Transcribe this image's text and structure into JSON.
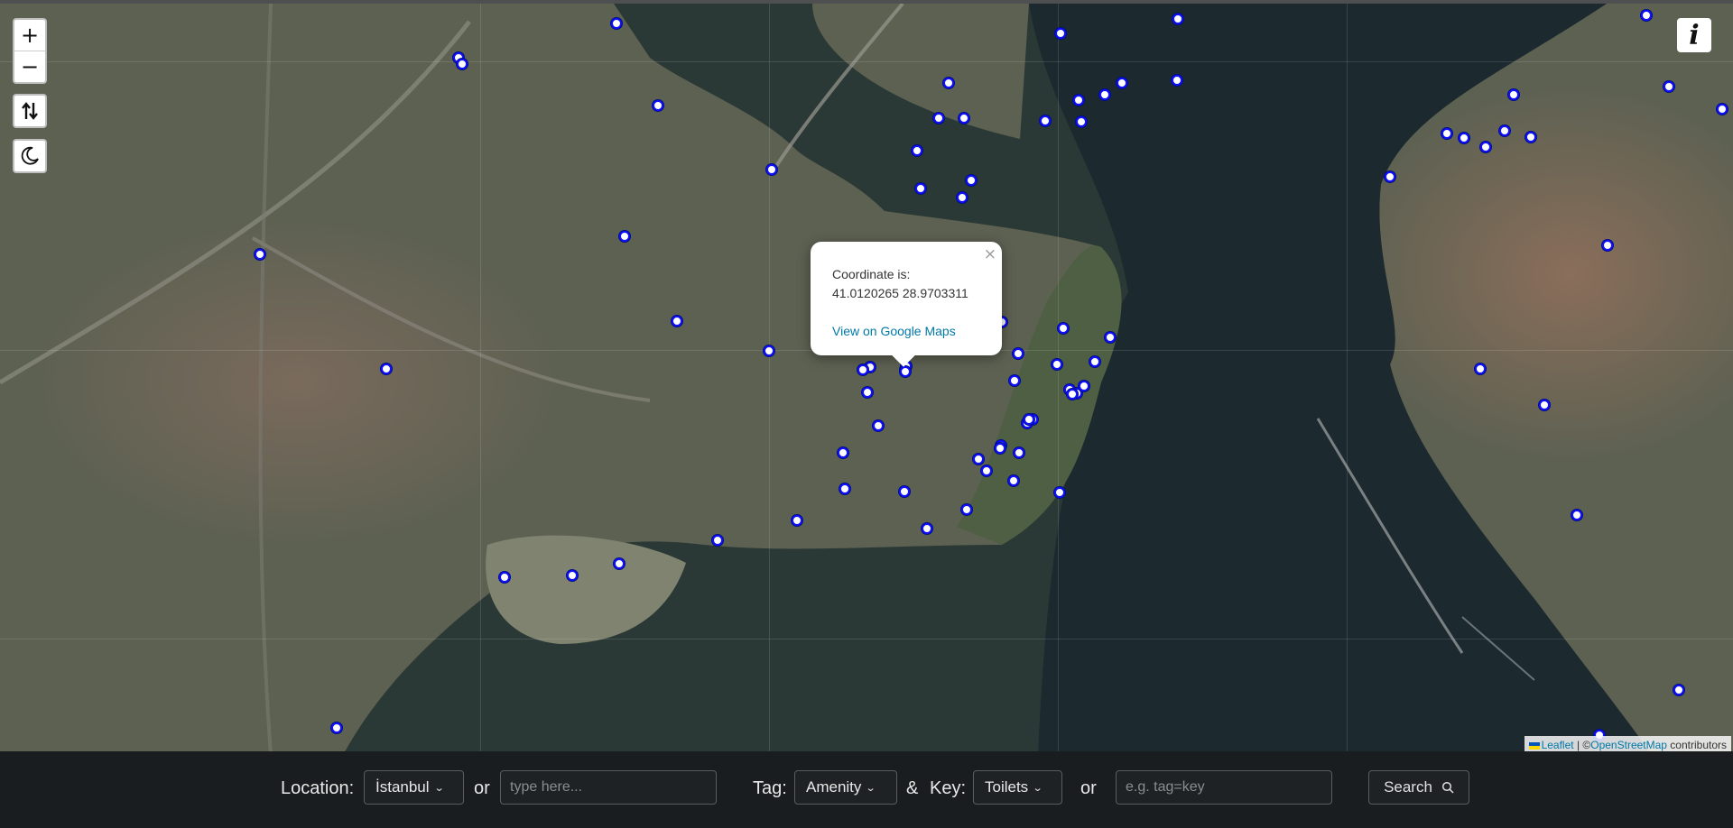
{
  "map": {
    "zoom_controls": {
      "zoom_in": "+",
      "zoom_out": "−"
    },
    "toggle_icons": [
      "swap-vertical-arrows-icon",
      "dark-mode-moon-icon"
    ],
    "info_button": "i",
    "popup": {
      "close": "×",
      "heading": "Coordinate is:",
      "coordinates": "41.0120265 28.9703311",
      "link": "View on Google Maps"
    },
    "attribution": {
      "leaflet": "Leaflet",
      "separator": " | ©",
      "osm": "OpenStreetMap",
      "suffix": " contributors"
    },
    "marker_color": "#1010ff"
  },
  "searchbar": {
    "location_label": "Location:",
    "location_value": "İstanbul",
    "or_1": "or",
    "location_placeholder": "type here...",
    "tag_label": "Tag:",
    "tag_value": "Amenity",
    "amp": "&",
    "key_label": "Key:",
    "key_value": "Toilets",
    "or_2": "or",
    "tagkey_placeholder": "e.g. tag=key",
    "search_label": "Search"
  }
}
